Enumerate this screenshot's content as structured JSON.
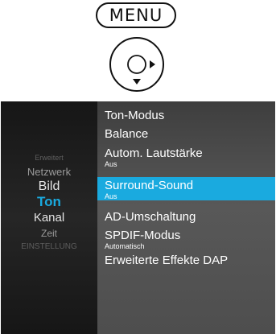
{
  "remote": {
    "menu_button_label": "MENU",
    "dpad_icon": "dpad-navigation-icon",
    "arrow_icons": [
      "arrow-right-icon",
      "arrow-down-icon"
    ]
  },
  "categories": {
    "erweitert": "Erweitert",
    "netzwerk": "Netzwerk",
    "bild": "Bild",
    "ton": "Ton",
    "kanal": "Kanal",
    "zeit": "Zeit",
    "einstellung": "EINSTELLUNG"
  },
  "ton_menu": {
    "items": [
      {
        "label": "Ton-Modus",
        "value": ""
      },
      {
        "label": "Balance",
        "value": ""
      },
      {
        "label": "Autom. Lautstärke",
        "value": "Aus"
      },
      {
        "label": "Surround-Sound",
        "value": "Aus"
      },
      {
        "label": "AD-Umschaltung",
        "value": ""
      },
      {
        "label": "SPDIF-Modus",
        "value": "Automatisch"
      },
      {
        "label": "Erweiterte Effekte DAP",
        "value": ""
      }
    ]
  },
  "colors": {
    "selected_background": "#1aaadf",
    "active_category": "#1aaadf"
  }
}
